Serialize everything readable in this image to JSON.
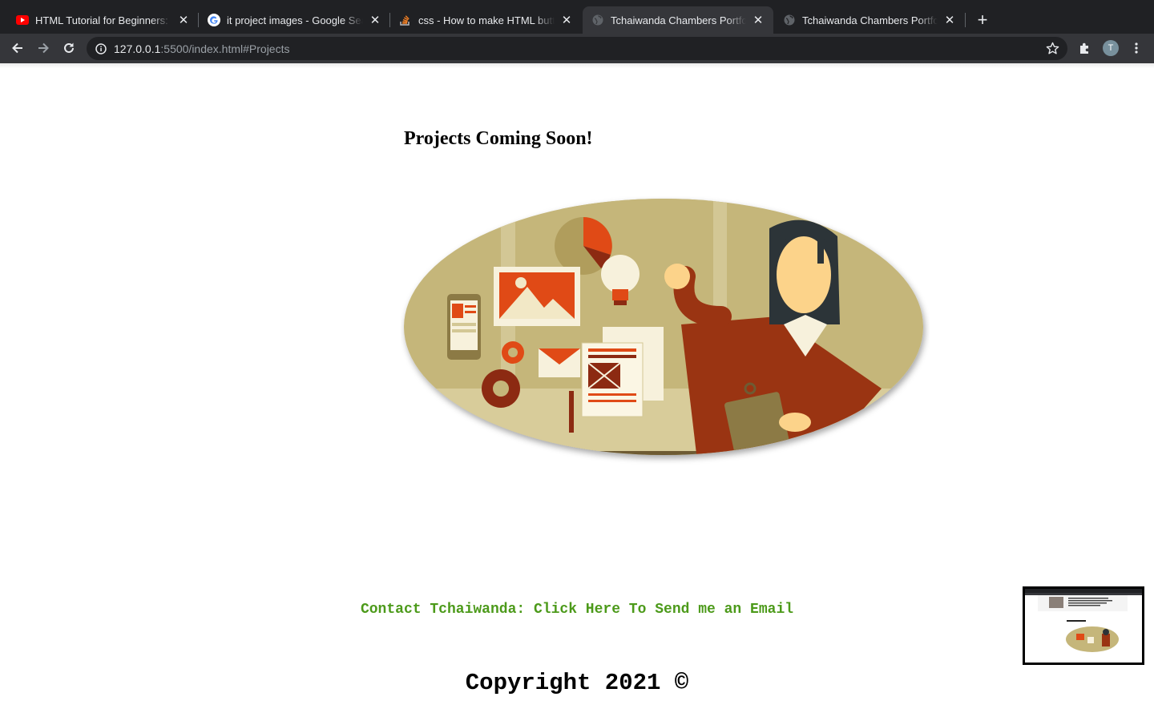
{
  "browser": {
    "tabs": [
      {
        "title": "HTML Tutorial for Beginners: HTML Crash Course",
        "favicon": "youtube-icon",
        "active": false
      },
      {
        "title": "it project images - Google Search",
        "favicon": "google-icon",
        "active": false
      },
      {
        "title": "css - How to make HTML button",
        "favicon": "stackoverflow-icon",
        "active": false
      },
      {
        "title": "Tchaiwanda Chambers Portfolio",
        "favicon": "globe-icon",
        "active": true
      },
      {
        "title": "Tchaiwanda Chambers Portfolio",
        "favicon": "globe-icon",
        "active": false
      }
    ],
    "address": {
      "host": "127.0.0.1",
      "rest": ":5500/index.html#Projects"
    },
    "profile_initial": "T"
  },
  "page": {
    "heading": "Projects Coming Soon!",
    "contact_link": "Contact Tchaiwanda: Click Here To Send me an Email",
    "copyright": "Copyright 2021 ©"
  },
  "colors": {
    "chrome_dark": "#202124",
    "chrome_toolbar": "#35363a",
    "link_green": "#4c9a1a",
    "illustration_tan": "#c5b67a",
    "illustration_red": "#e04a16",
    "illustration_maroon": "#8c2a12"
  }
}
